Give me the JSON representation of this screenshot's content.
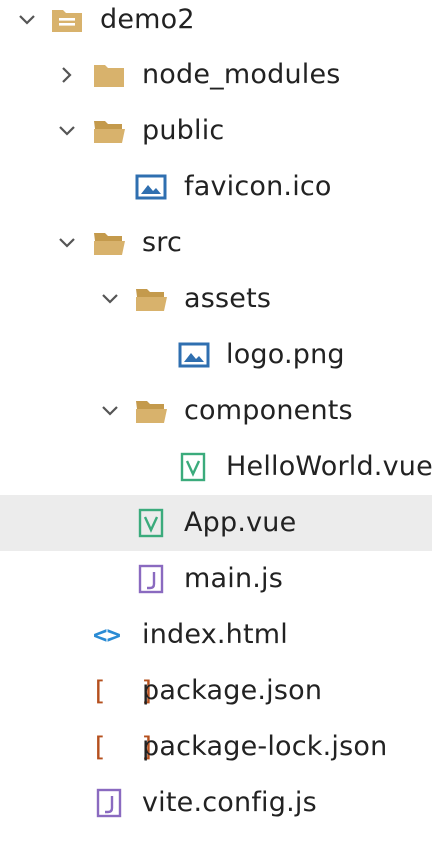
{
  "tree": [
    {
      "label": "demo2",
      "type": "project",
      "icon": "project-folder-icon",
      "expanded": true,
      "selected": false
    },
    {
      "label": "node_modules",
      "type": "folder",
      "icon": "folder-icon",
      "expanded": false,
      "selected": false
    },
    {
      "label": "public",
      "type": "folder",
      "icon": "folder-icon",
      "expanded": true,
      "selected": false
    },
    {
      "label": "favicon.ico",
      "type": "file",
      "icon": "image-file-icon",
      "selected": false
    },
    {
      "label": "src",
      "type": "folder",
      "icon": "folder-icon",
      "expanded": true,
      "selected": false
    },
    {
      "label": "assets",
      "type": "folder",
      "icon": "folder-icon",
      "expanded": true,
      "selected": false
    },
    {
      "label": "logo.png",
      "type": "file",
      "icon": "image-file-icon",
      "selected": false
    },
    {
      "label": "components",
      "type": "folder",
      "icon": "folder-icon",
      "expanded": true,
      "selected": false
    },
    {
      "label": "HelloWorld.vue",
      "type": "file",
      "icon": "vue-file-icon",
      "selected": false
    },
    {
      "label": "App.vue",
      "type": "file",
      "icon": "vue-file-icon",
      "selected": true
    },
    {
      "label": "main.js",
      "type": "file",
      "icon": "js-file-icon",
      "selected": false
    },
    {
      "label": "index.html",
      "type": "file",
      "icon": "html-file-icon",
      "selected": false
    },
    {
      "label": "package.json",
      "type": "file",
      "icon": "json-file-icon",
      "selected": false
    },
    {
      "label": "package-lock.json",
      "type": "file",
      "icon": "json-file-icon",
      "selected": false
    },
    {
      "label": "vite.config.js",
      "type": "file",
      "icon": "js-file-icon",
      "selected": false
    }
  ],
  "icons": {
    "html_glyph": "<>",
    "json_glyph": "[ ]"
  },
  "colors": {
    "folder": "#d8b26c",
    "folder_dark": "#c49a4c",
    "image": "#2f6fb0",
    "vue": "#3bab7c",
    "js": "#8a6ac0",
    "html": "#2a8bd4",
    "json": "#b5501e",
    "selected_bg": "#ececec",
    "chevron": "#555555"
  }
}
